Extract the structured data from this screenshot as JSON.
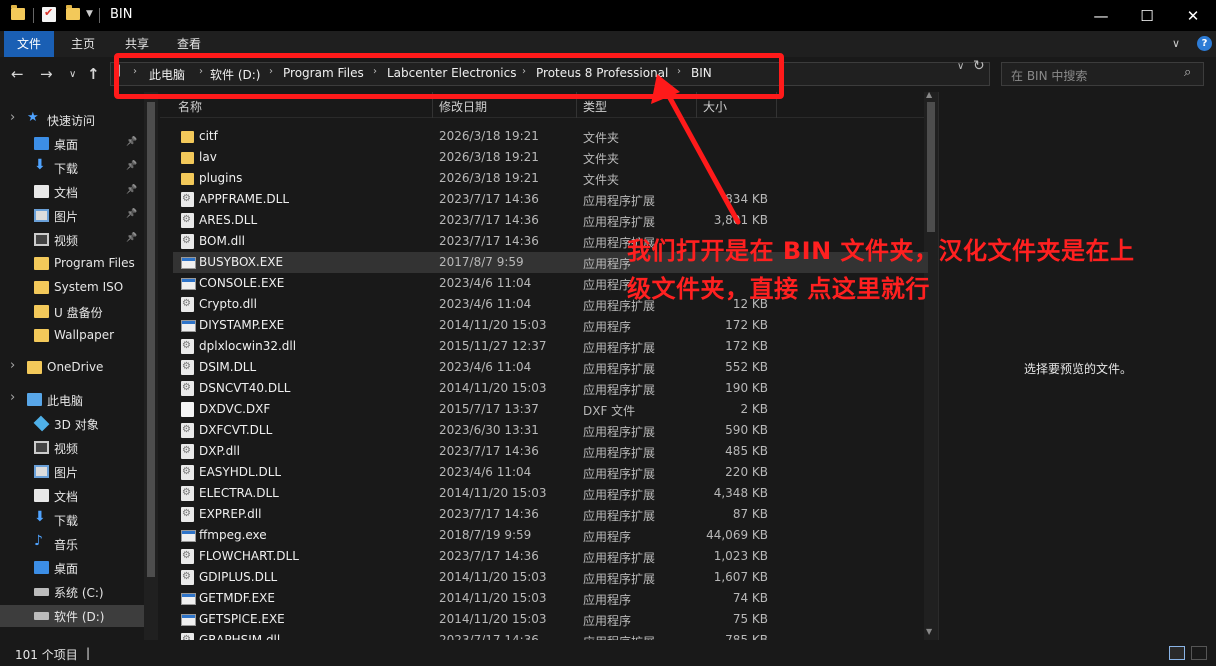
{
  "window": {
    "title": "BIN",
    "controls": {
      "minimize": "—",
      "maximize": "☐",
      "close": "✕"
    }
  },
  "ribbon": {
    "tabs": [
      "文件",
      "主页",
      "共享",
      "查看"
    ]
  },
  "address": {
    "crumbs": [
      "此电脑",
      "软件 (D:)",
      "Program Files",
      "Labcenter Electronics",
      "Proteus 8 Professional",
      "BIN"
    ],
    "search_placeholder": "在 BIN 中搜索"
  },
  "sidebar": {
    "quick_access_label": "快速访问",
    "quick_items": [
      {
        "label": "桌面",
        "icon": "desktop-icon",
        "pinned": true
      },
      {
        "label": "下载",
        "icon": "download-icon",
        "pinned": true
      },
      {
        "label": "文档",
        "icon": "documents-icon",
        "pinned": true
      },
      {
        "label": "图片",
        "icon": "pictures-icon",
        "pinned": true
      },
      {
        "label": "视频",
        "icon": "videos-icon",
        "pinned": true
      },
      {
        "label": "Program Files",
        "icon": "folder-icon",
        "pinned": false
      },
      {
        "label": "System ISO",
        "icon": "folder-icon",
        "pinned": false
      },
      {
        "label": "U 盘备份",
        "icon": "folder-icon",
        "pinned": false
      },
      {
        "label": "Wallpaper",
        "icon": "folder-icon",
        "pinned": false
      }
    ],
    "onedrive_label": "OneDrive",
    "this_pc_label": "此电脑",
    "pc_items": [
      {
        "label": "3D 对象",
        "icon": "3d-objects-icon"
      },
      {
        "label": "视频",
        "icon": "videos-icon"
      },
      {
        "label": "图片",
        "icon": "pictures-icon"
      },
      {
        "label": "文档",
        "icon": "documents-icon"
      },
      {
        "label": "下载",
        "icon": "download-icon"
      },
      {
        "label": "音乐",
        "icon": "music-icon"
      },
      {
        "label": "桌面",
        "icon": "desktop-icon"
      },
      {
        "label": "系统 (C:)",
        "icon": "drive-icon"
      },
      {
        "label": "软件 (D:)",
        "icon": "drive-icon"
      }
    ]
  },
  "columns": {
    "name": "名称",
    "date": "修改日期",
    "type": "类型",
    "size": "大小"
  },
  "files": [
    {
      "name": "citf",
      "date": "2026/3/18 19:21",
      "type": "文件夹",
      "size": "",
      "kind": "folder"
    },
    {
      "name": "lav",
      "date": "2026/3/18 19:21",
      "type": "文件夹",
      "size": "",
      "kind": "folder"
    },
    {
      "name": "plugins",
      "date": "2026/3/18 19:21",
      "type": "文件夹",
      "size": "",
      "kind": "folder"
    },
    {
      "name": "APPFRAME.DLL",
      "date": "2023/7/17 14:36",
      "type": "应用程序扩展",
      "size": "834 KB",
      "kind": "dll"
    },
    {
      "name": "ARES.DLL",
      "date": "2023/7/17 14:36",
      "type": "应用程序扩展",
      "size": "3,801 KB",
      "kind": "dll"
    },
    {
      "name": "BOM.dll",
      "date": "2023/7/17 14:36",
      "type": "应用程序扩展",
      "size": "",
      "kind": "dll"
    },
    {
      "name": "BUSYBOX.EXE",
      "date": "2017/8/7 9:59",
      "type": "应用程序",
      "size": "",
      "kind": "exe"
    },
    {
      "name": "CONSOLE.EXE",
      "date": "2023/4/6 11:04",
      "type": "应用程序",
      "size": "",
      "kind": "exe"
    },
    {
      "name": "Crypto.dll",
      "date": "2023/4/6 11:04",
      "type": "应用程序扩展",
      "size": "12 KB",
      "kind": "dll"
    },
    {
      "name": "DIYSTAMP.EXE",
      "date": "2014/11/20 15:03",
      "type": "应用程序",
      "size": "172 KB",
      "kind": "exe"
    },
    {
      "name": "dplxlocwin32.dll",
      "date": "2015/11/27 12:37",
      "type": "应用程序扩展",
      "size": "172 KB",
      "kind": "dll"
    },
    {
      "name": "DSIM.DLL",
      "date": "2023/4/6 11:04",
      "type": "应用程序扩展",
      "size": "552 KB",
      "kind": "dll"
    },
    {
      "name": "DSNCVT40.DLL",
      "date": "2014/11/20 15:03",
      "type": "应用程序扩展",
      "size": "190 KB",
      "kind": "dll"
    },
    {
      "name": "DXDVC.DXF",
      "date": "2015/7/17 13:37",
      "type": "DXF 文件",
      "size": "2 KB",
      "kind": "file"
    },
    {
      "name": "DXFCVT.DLL",
      "date": "2023/6/30 13:31",
      "type": "应用程序扩展",
      "size": "590 KB",
      "kind": "dll"
    },
    {
      "name": "DXP.dll",
      "date": "2023/7/17 14:36",
      "type": "应用程序扩展",
      "size": "485 KB",
      "kind": "dll"
    },
    {
      "name": "EASYHDL.DLL",
      "date": "2023/4/6 11:04",
      "type": "应用程序扩展",
      "size": "220 KB",
      "kind": "dll"
    },
    {
      "name": "ELECTRA.DLL",
      "date": "2014/11/20 15:03",
      "type": "应用程序扩展",
      "size": "4,348 KB",
      "kind": "dll"
    },
    {
      "name": "EXPREP.dll",
      "date": "2023/7/17 14:36",
      "type": "应用程序扩展",
      "size": "87 KB",
      "kind": "dll"
    },
    {
      "name": "ffmpeg.exe",
      "date": "2018/7/19 9:59",
      "type": "应用程序",
      "size": "44,069 KB",
      "kind": "exe"
    },
    {
      "name": "FLOWCHART.DLL",
      "date": "2023/7/17 14:36",
      "type": "应用程序扩展",
      "size": "1,023 KB",
      "kind": "dll"
    },
    {
      "name": "GDIPLUS.DLL",
      "date": "2014/11/20 15:03",
      "type": "应用程序扩展",
      "size": "1,607 KB",
      "kind": "dll"
    },
    {
      "name": "GETMDF.EXE",
      "date": "2014/11/20 15:03",
      "type": "应用程序",
      "size": "74 KB",
      "kind": "exe"
    },
    {
      "name": "GETSPICE.EXE",
      "date": "2014/11/20 15:03",
      "type": "应用程序",
      "size": "75 KB",
      "kind": "exe"
    },
    {
      "name": "GRAPHSIM.dll",
      "date": "2023/7/17 14:36",
      "type": "应用程序扩展",
      "size": "785 KB",
      "kind": "dll"
    }
  ],
  "highlighted_row": 6,
  "preview": {
    "message": "选择要预览的文件。"
  },
  "status": {
    "count": "101 个项目"
  },
  "annotation": {
    "line1": "我们打开是在 BIN 文件夹，汉化文件夹是在上",
    "line2": "级文件夹，直接 点这里就行",
    "color": "#ff2020"
  }
}
